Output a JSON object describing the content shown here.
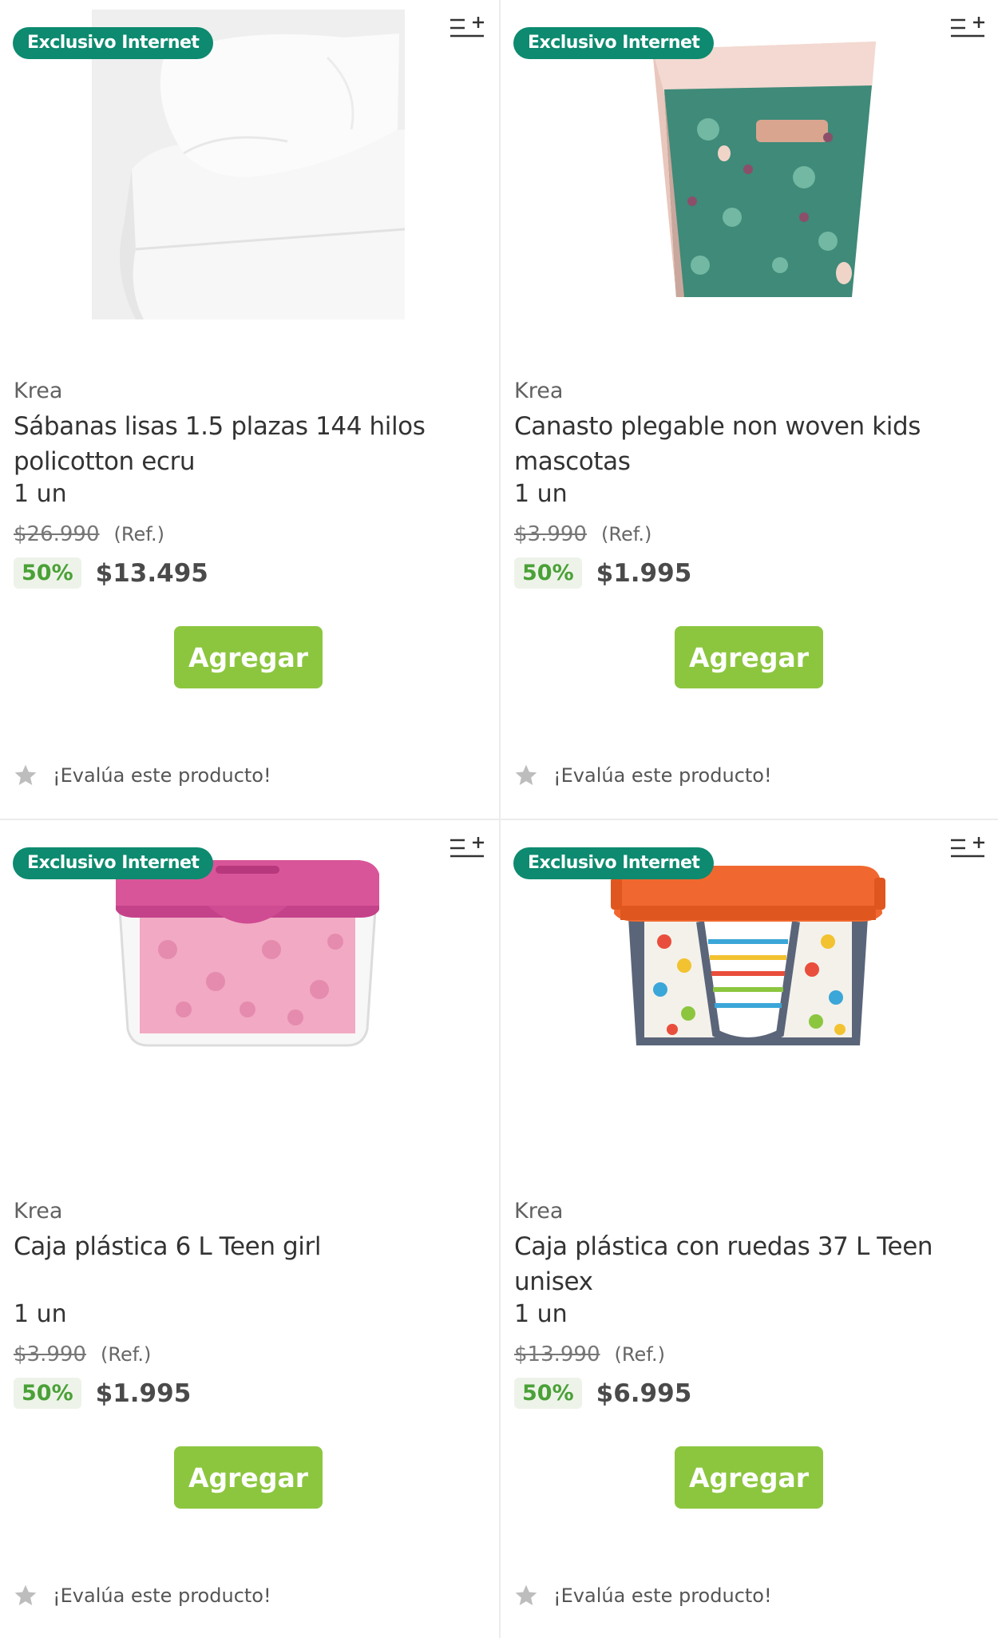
{
  "colors": {
    "badge": "#0d8a6f",
    "button": "#8cc63f",
    "discount_text": "#4aa137",
    "discount_bg": "#eef3ea"
  },
  "products": [
    {
      "badge": "Exclusivo Internet",
      "brand": "Krea",
      "title": "Sábanas lisas 1.5 plazas 144 hilos policotton ecru",
      "quantity": "1 un",
      "old_price": "$26.990",
      "ref": "(Ref.)",
      "discount": "50%",
      "price": "$13.495",
      "button": "Agregar",
      "rating_text": "¡Evalúa este producto!",
      "image_icon": "bed-sheets-image"
    },
    {
      "badge": "Exclusivo Internet",
      "brand": "Krea",
      "title": "Canasto plegable non woven kids mascotas",
      "quantity": "1 un",
      "old_price": "$3.990",
      "ref": "(Ref.)",
      "discount": "50%",
      "price": "$1.995",
      "button": "Agregar",
      "rating_text": "¡Evalúa este producto!",
      "image_icon": "storage-basket-image"
    },
    {
      "badge": "Exclusivo Internet",
      "brand": "Krea",
      "title": "Caja plástica 6 L Teen girl",
      "quantity": "1 un",
      "old_price": "$3.990",
      "ref": "(Ref.)",
      "discount": "50%",
      "price": "$1.995",
      "button": "Agregar",
      "rating_text": "¡Evalúa este producto!",
      "image_icon": "pink-plastic-box-image"
    },
    {
      "badge": "Exclusivo Internet",
      "brand": "Krea",
      "title": "Caja plástica con ruedas 37 L Teen unisex",
      "quantity": "1 un",
      "old_price": "$13.990",
      "ref": "(Ref.)",
      "discount": "50%",
      "price": "$6.995",
      "button": "Agregar",
      "rating_text": "¡Evalúa este producto!",
      "image_icon": "orange-plastic-box-image"
    }
  ]
}
